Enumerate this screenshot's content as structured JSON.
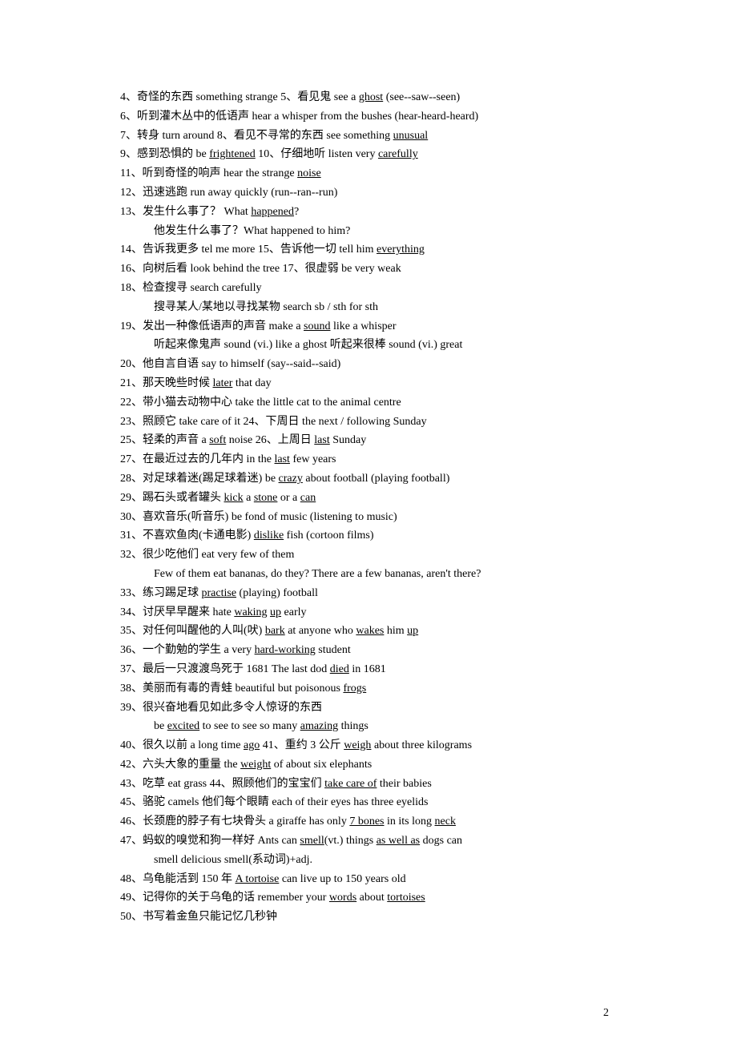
{
  "lines": [
    {
      "n": "4",
      "text": "、奇怪的东西 something strange 5、看见鬼 see a <u>ghost</u> (see--saw--seen)"
    },
    {
      "n": "6",
      "text": "、听到灌木丛中的低语声 hear a whisper from the bushes (hear-heard-heard)"
    },
    {
      "n": "7",
      "text": "、转身 turn around  8、看见不寻常的东西 see something <u>unusual</u>"
    },
    {
      "n": "9",
      "text": "、感到恐惧的 be <u>frightened</u> 10、仔细地听 listen very <u>carefully</u>"
    },
    {
      "n": "11",
      "text": "、听到奇怪的响声 hear the strange <u>noise</u>"
    },
    {
      "n": "12",
      "text": "、迅速逃跑 run away quickly (run--ran--run)"
    },
    {
      "n": "13",
      "text": "、发生什么事了？ What <u>happened</u>?"
    },
    {
      "sub": true,
      "text": "他发生什么事了？What happened to him?"
    },
    {
      "n": "14",
      "text": "、告诉我更多 tel me more 15、告诉他一切 tell him <u>everything</u>"
    },
    {
      "n": "16",
      "text": "、向树后看 look behind the tree 17、很虚弱 be very weak"
    },
    {
      "n": "18",
      "text": "、检查搜寻 search carefully"
    },
    {
      "sub": true,
      "text": "搜寻某人/某地以寻找某物 search sb / sth for sth"
    },
    {
      "n": "19",
      "text": "、发出一种像低语声的声音 make a <u>sound</u> like a whisper"
    },
    {
      "sub": true,
      "text": "听起来像鬼声 sound (vi.) like a ghost    听起来很棒 sound (vi.) great"
    },
    {
      "n": "20",
      "text": "、他自言自语 say to himself (say--said--said)"
    },
    {
      "n": "21",
      "text": "、那天晚些时候 <u>later</u> that day"
    },
    {
      "n": "22",
      "text": "、带小猫去动物中心 take the little cat to the animal centre"
    },
    {
      "n": "23",
      "text": "、照顾它 take care of it       24、下周日 the next / following Sunday"
    },
    {
      "n": "25",
      "text": "、轻柔的声音 a <u>soft</u> noise     26、上周日 <u>last</u> Sunday"
    },
    {
      "n": "27",
      "text": "、在最近过去的几年内 in the <u>last</u> few years"
    },
    {
      "n": "28",
      "text": "、对足球着迷(踢足球着迷) be <u>crazy</u> about football (playing football)"
    },
    {
      "n": "29",
      "text": "、踢石头或者罐头 <u>kick</u> a <u>stone</u> or a <u>can</u>"
    },
    {
      "n": "30",
      "text": "、喜欢音乐(听音乐) be fond of music (listening to music)"
    },
    {
      "n": "31",
      "text": "、不喜欢鱼肉(卡通电影) <u>dislike</u> fish (cortoon films)"
    },
    {
      "n": "32",
      "text": "、很少吃他们 eat very few of them"
    },
    {
      "sub": true,
      "text": "Few of them eat bananas, do they?  There are a few bananas, aren't there?"
    },
    {
      "n": "33",
      "text": "、练习踢足球 <u>practise</u> (playing) football"
    },
    {
      "n": "34",
      "text": "、讨厌早早醒来 hate <u>waking</u> <u>up</u> early"
    },
    {
      "n": "35",
      "text": "、对任何叫醒他的人叫(吠) <u>bark</u> at anyone who <u>wakes</u> him <u>up</u>"
    },
    {
      "n": "36",
      "text": "、一个勤勉的学生 a very <u>hard-working</u> student"
    },
    {
      "n": "37",
      "text": "、最后一只渡渡鸟死于 1681 The last dod <u>died</u> in 1681"
    },
    {
      "n": "38",
      "text": "、美丽而有毒的青蛙 beautiful but poisonous <u>frogs</u>"
    },
    {
      "n": "39",
      "text": "、很兴奋地看见如此多令人惊讶的东西"
    },
    {
      "sub": true,
      "text": "be <u>excited</u> to see to see so many <u>amazing</u> things"
    },
    {
      "n": "40",
      "text": "、很久以前 a long time <u>ago</u>  41、重约 3 公斤 <u>weigh</u> about three kilograms"
    },
    {
      "n": "42",
      "text": "、六头大象的重量 the <u>weight</u> of about six elephants"
    },
    {
      "n": "43",
      "text": "、吃草 eat grass  44、照顾他们的宝宝们 <u>take care of</u> their babies"
    },
    {
      "n": "45",
      "text": "、骆驼 camels 他们每个眼睛 each of their eyes has three eyelids"
    },
    {
      "n": "46",
      "text": "、长颈鹿的脖子有七块骨头 a giraffe has only <u>7 bones</u> in its long <u>neck</u>"
    },
    {
      "n": "47",
      "text": "、蚂蚁的嗅觉和狗一样好 Ants can <u>smell</u>(vt.) things <u>as well as</u> dogs can"
    },
    {
      "sub": true,
      "text": "smell delicious   smell(系动词)+adj."
    },
    {
      "n": "48",
      "text": "、乌龟能活到 150 年 <u>A tortoise</u> can live up to 150 years old"
    },
    {
      "n": "49",
      "text": "、记得你的关于乌龟的话 remember your <u>words</u> about <u>tortoises</u>"
    },
    {
      "n": "50",
      "text": "、书写着金鱼只能记忆几秒钟"
    }
  ],
  "pageNumber": "2"
}
